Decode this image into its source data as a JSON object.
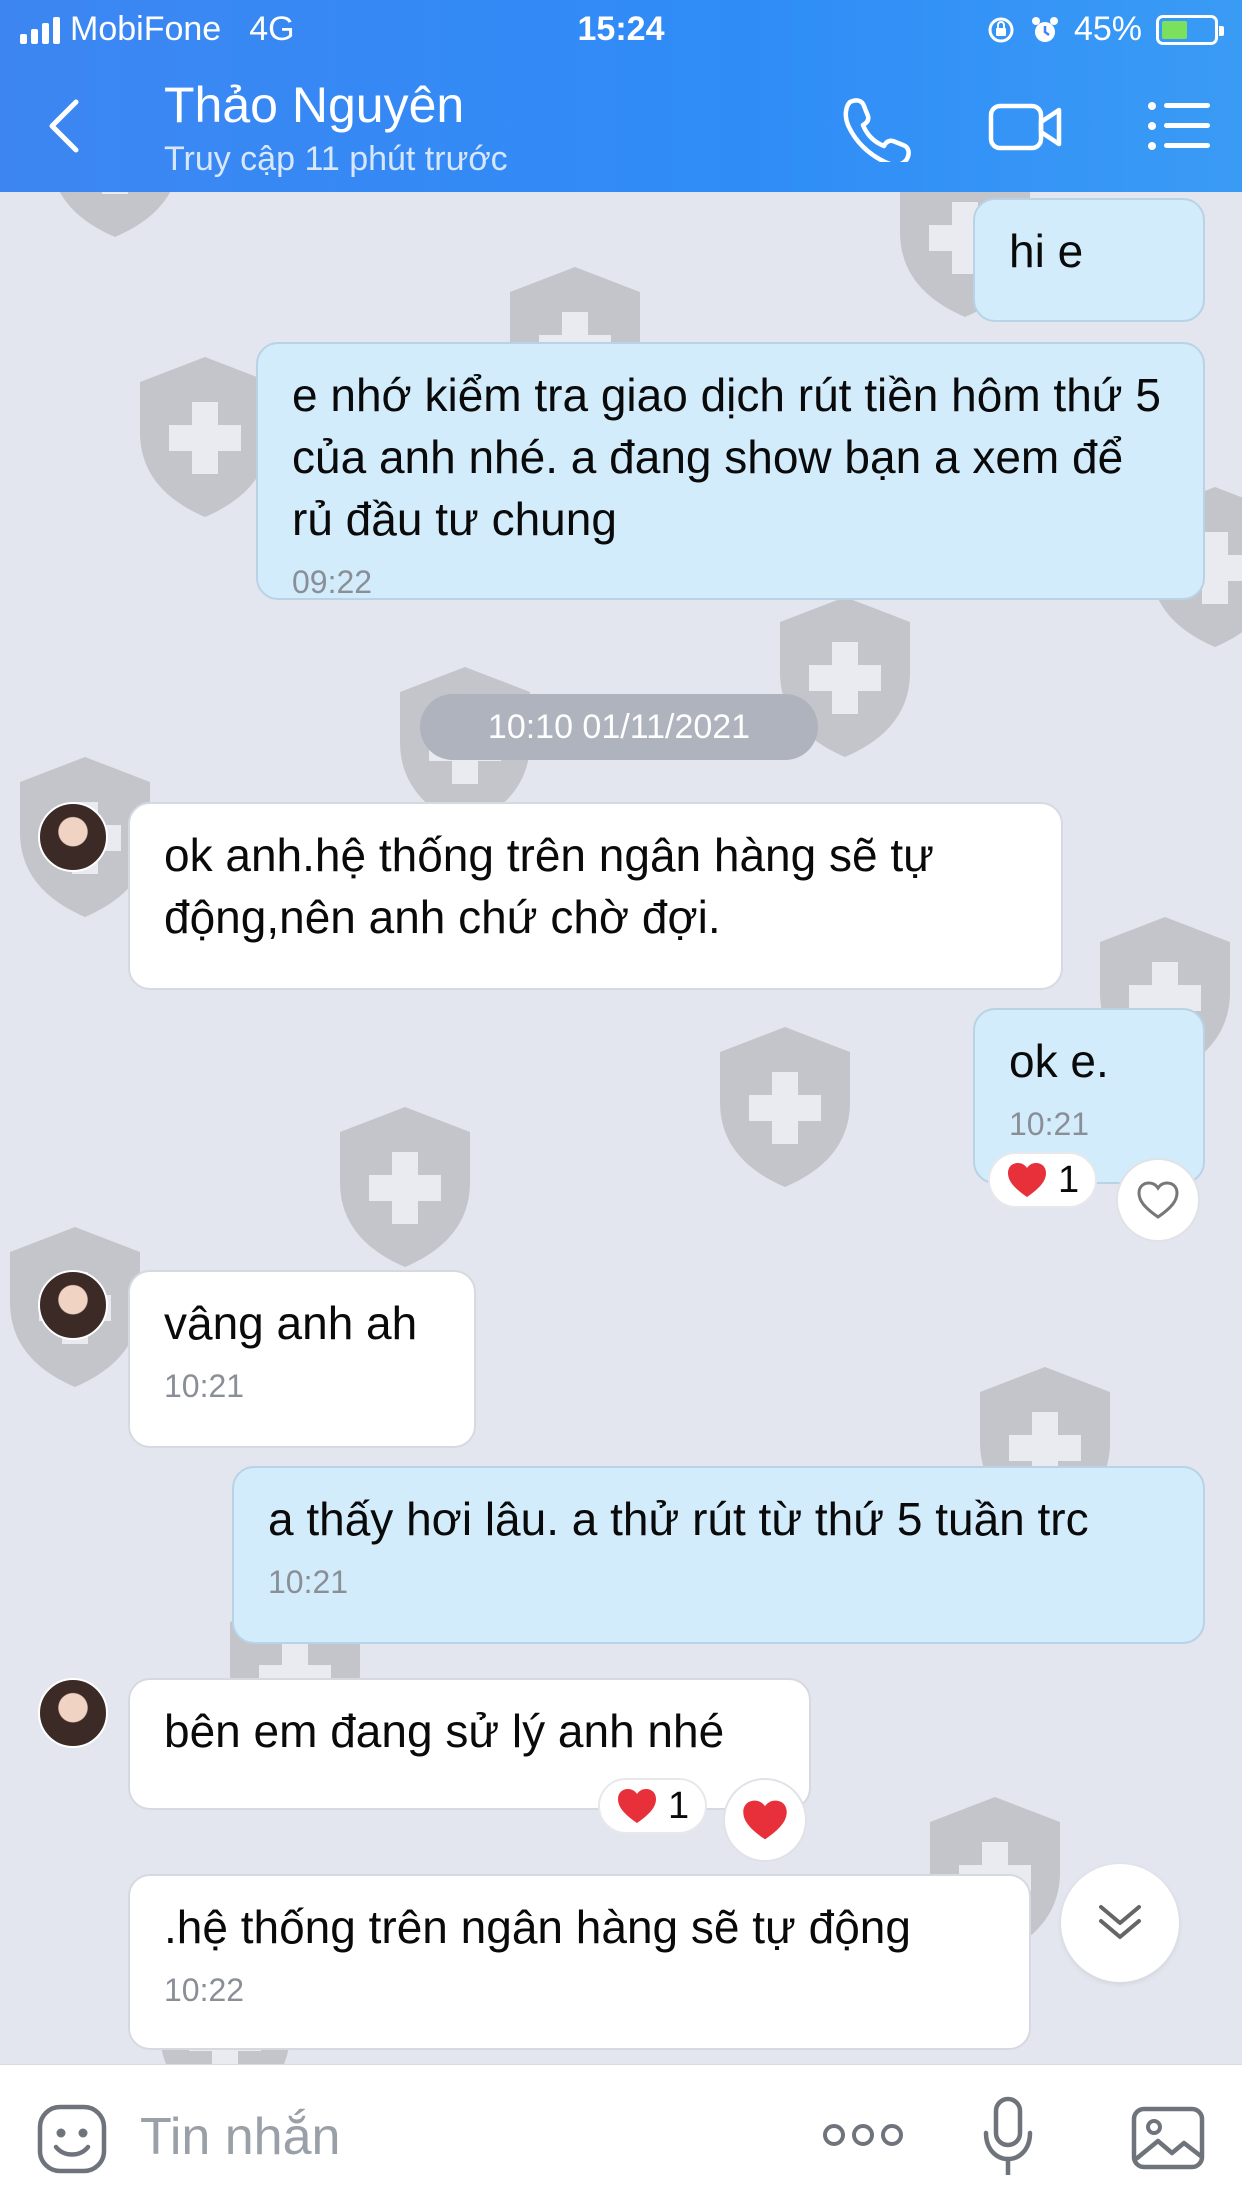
{
  "status_bar": {
    "carrier": "MobiFone",
    "network": "4G",
    "time": "15:24",
    "battery": "45%"
  },
  "header": {
    "contact_name": "Thảo Nguyên",
    "contact_status": "Truy cập 11 phút trước",
    "icons": [
      "back-icon",
      "phone-icon",
      "video-call-icon",
      "menu-icon"
    ]
  },
  "chat": {
    "messages": [
      {
        "side": "out",
        "text": "hi e",
        "time": ""
      },
      {
        "side": "out",
        "text": "e nhớ kiểm tra giao dịch rút tiền hôm thứ 5 của anh nhé. a đang show bạn a xem để rủ đầu tư chung",
        "time": "09:22"
      },
      {
        "side": "in",
        "text": "ok anh.hệ thống trên ngân hàng sẽ tự động,nên anh chứ chờ đợi.",
        "time": ""
      },
      {
        "side": "out",
        "text": "ok e.",
        "time": "10:21",
        "reaction_count": "1"
      },
      {
        "side": "in",
        "text": "vâng anh ah",
        "time": "10:21"
      },
      {
        "side": "out",
        "text": "a thấy hơi lâu. a thử rút từ thứ 5 tuần trc",
        "time": "10:21"
      },
      {
        "side": "in",
        "text": "bên em đang sử lý anh nhé",
        "time": "",
        "reaction_count": "1"
      },
      {
        "side": "in",
        "text": ".hệ thống trên ngân hàng sẽ tự động",
        "time": "10:22"
      }
    ],
    "date_separator": "10:10 01/11/2021"
  },
  "input_bar": {
    "placeholder": "Tin nhắn",
    "icons": [
      "emoji-icon",
      "more-icon",
      "microphone-icon",
      "image-icon"
    ]
  },
  "colors": {
    "header_blue": "#3d86f2",
    "outgoing_bubble": "#d3ecfb",
    "incoming_bubble": "#ffffff",
    "chat_background": "#e3e6ee",
    "heart": "#e8303a"
  }
}
